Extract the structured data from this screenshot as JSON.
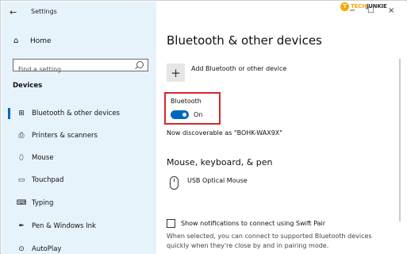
{
  "window": {
    "back_glyph": "←",
    "title": "Settings"
  },
  "window_controls": {
    "minimize": "−",
    "maximize": "☐",
    "close": "×"
  },
  "logo": {
    "badge": "T",
    "text_a": "TECH",
    "text_b": "JUNKIE"
  },
  "sidebar": {
    "home": {
      "icon": "home-icon",
      "glyph": "⌂",
      "label": "Home"
    },
    "search_placeholder": "Find a setting",
    "section": "Devices",
    "items": [
      {
        "id": "bluetooth",
        "icon": "bluetooth-devices-icon",
        "glyph": "⊞",
        "label": "Bluetooth & other devices",
        "selected": true
      },
      {
        "id": "printers",
        "icon": "printer-icon",
        "glyph": "⎙",
        "label": "Printers & scanners",
        "selected": false
      },
      {
        "id": "mouse",
        "icon": "mouse-icon",
        "glyph": "⬯",
        "label": "Mouse",
        "selected": false
      },
      {
        "id": "touchpad",
        "icon": "touchpad-icon",
        "glyph": "▭",
        "label": "Touchpad",
        "selected": false
      },
      {
        "id": "typing",
        "icon": "keyboard-icon",
        "glyph": "⌨",
        "label": "Typing",
        "selected": false
      },
      {
        "id": "pen",
        "icon": "pen-icon",
        "glyph": "✒",
        "label": "Pen & Windows Ink",
        "selected": false
      },
      {
        "id": "autoplay",
        "icon": "autoplay-icon",
        "glyph": "⊙",
        "label": "AutoPlay",
        "selected": false
      }
    ]
  },
  "main": {
    "title": "Bluetooth & other devices",
    "add_icon": "+",
    "add_label": "Add Bluetooth or other device",
    "bluetooth_label": "Bluetooth",
    "bluetooth_state": "On",
    "discoverable": "Now discoverable as \"BOHK-WAX9X\"",
    "mkp_heading": "Mouse, keyboard, & pen",
    "device_name": "USB Optical Mouse",
    "swift_pair_label": "Show notifications to connect using Swift Pair",
    "swift_pair_desc": "When selected, you can connect to supported Bluetooth devices quickly when they're close by and in pairing mode."
  },
  "colors": {
    "accent": "#0067c0",
    "sidebar_bg": "#e7f3fb",
    "highlight_box": "#d8262b"
  }
}
